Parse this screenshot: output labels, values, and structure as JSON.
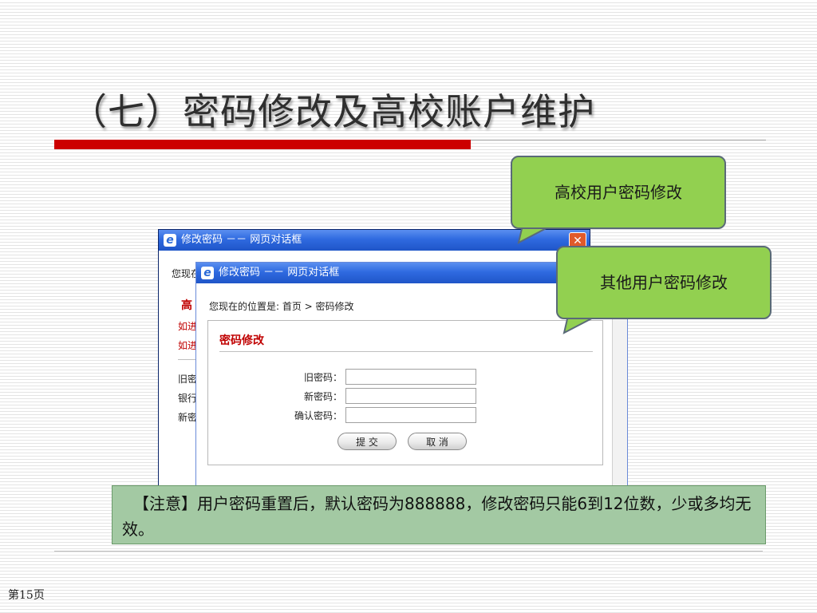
{
  "slide": {
    "title": "（七）密码修改及高校账户维护",
    "page_number": "第15页",
    "accent_color": "#cc0000"
  },
  "callouts": {
    "school_user": "高校用户密码修改",
    "other_user": "其他用户密码修改",
    "fill_color": "#92d050"
  },
  "back_dialog": {
    "title": "修改密码 －－ 网页对话框",
    "close_icon": "close-icon",
    "location_partial": "您现在",
    "heading_partial": "高",
    "line1_partial": "如进",
    "line2_partial": "如进",
    "field1_partial": "旧密",
    "field2_partial": "银行",
    "field3_partial": "新密"
  },
  "front_dialog": {
    "title": "修改密码 －－ 网页对话框",
    "location": "您现在的位置是: 首页  > 密码修改",
    "panel_title": "密码修改",
    "fields": [
      {
        "label": "旧密码：",
        "value": ""
      },
      {
        "label": "新密码：",
        "value": ""
      },
      {
        "label": "确认密码：",
        "value": ""
      }
    ],
    "submit_label": "提 交",
    "cancel_label": "取 消"
  },
  "note": {
    "text": "【注意】用户密码重置后，默认密码为888888，修改密码只能6到12位数，少或多均无效。"
  }
}
